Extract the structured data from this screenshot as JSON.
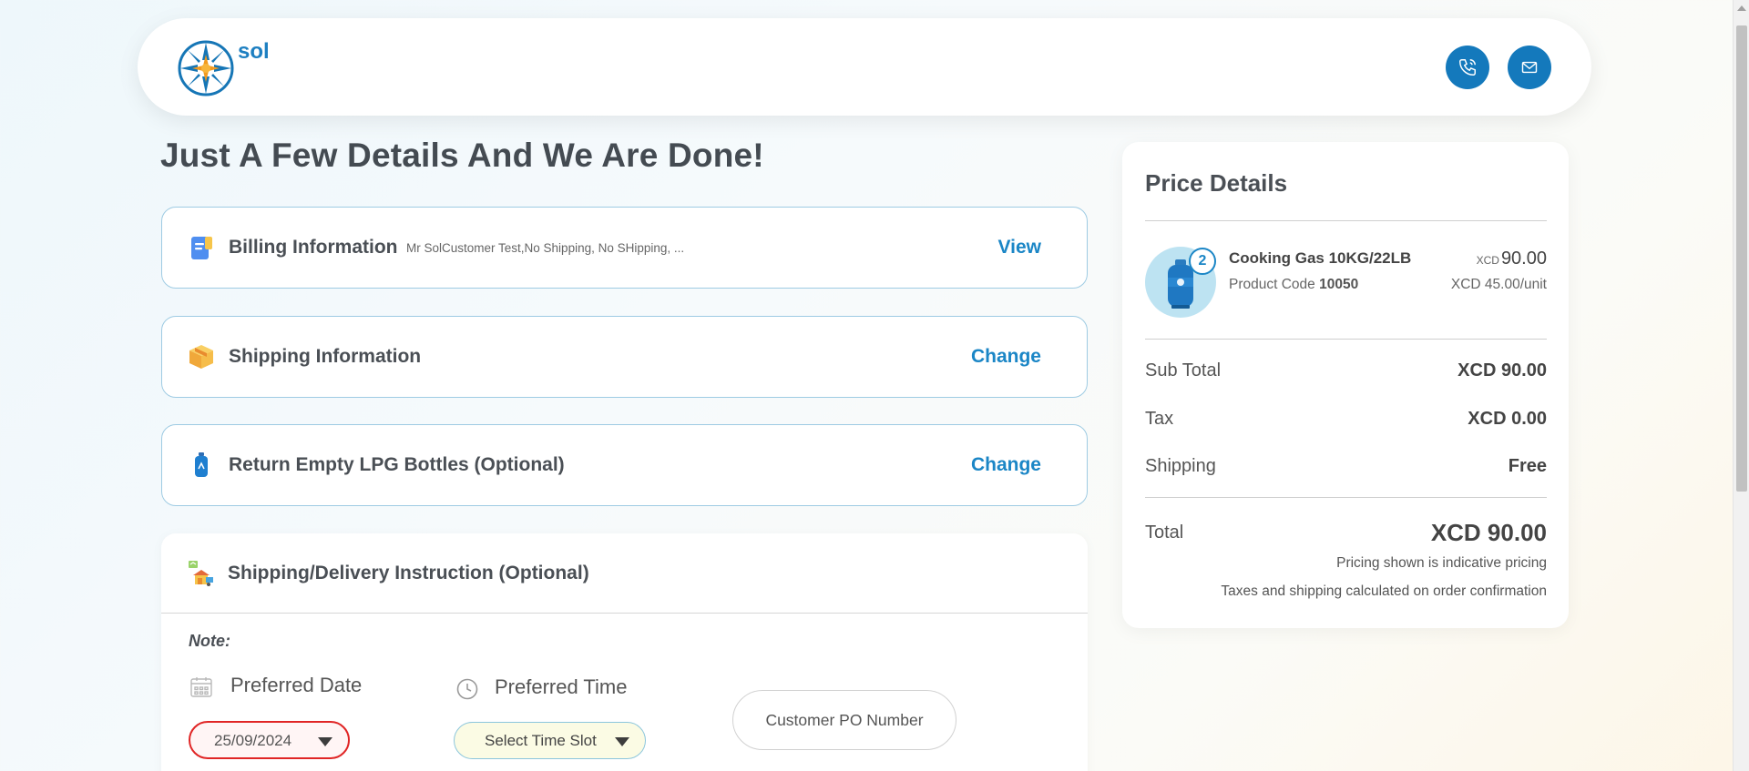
{
  "header": {
    "logo_text": "sol",
    "phone_icon": "phone-icon",
    "mail_icon": "mail-icon"
  },
  "page_title": "Just A Few Details And We Are Done!",
  "steps": [
    {
      "label": "Billing Information",
      "summary": "Mr SolCustomer Test,No Shipping, No SHipping, ...",
      "action": "View",
      "icon": "receipt-icon"
    },
    {
      "label": "Shipping Information",
      "summary": "",
      "action": "Change",
      "icon": "package-icon"
    },
    {
      "label": "Return Empty LPG Bottles (Optional)",
      "summary": "",
      "action": "Change",
      "icon": "gas-bottle-icon"
    }
  ],
  "instruction": {
    "label": "Shipping/Delivery Instruction (Optional)",
    "note": "Note:",
    "preferred_date_label": "Preferred Date",
    "preferred_date_value": "25/09/2024",
    "preferred_time_label": "Preferred Time",
    "time_slot_placeholder": "Select Time Slot",
    "po_number_placeholder": "Customer PO Number"
  },
  "price_details": {
    "title": "Price Details",
    "product": {
      "name": "Cooking Gas 10KG/22LB",
      "code_label": "Product Code",
      "code": "10050",
      "quantity": "2",
      "currency_small": "XCD",
      "price": "90.00",
      "unit_price": "XCD 45.00/unit"
    },
    "sub_total_label": "Sub Total",
    "sub_total": "XCD 90.00",
    "tax_label": "Tax",
    "tax": "XCD 0.00",
    "shipping_label": "Shipping",
    "shipping": "Free",
    "total_label": "Total",
    "total": "XCD 90.00",
    "note_1": "Pricing shown is indicative pricing",
    "note_2": "Taxes and shipping calculated on order confirmation"
  },
  "colors": {
    "accent": "#1b86c6",
    "header_button": "#1479bc",
    "date_error_border": "#e02525"
  }
}
